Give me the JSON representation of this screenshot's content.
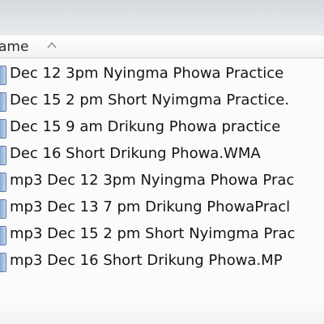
{
  "column_header": {
    "label": "ame"
  },
  "files": [
    {
      "name": "Dec 12 3pm Nyingma Phowa Practice",
      "icon": "audio-file-icon"
    },
    {
      "name": "Dec 15 2 pm Short Nyimgma Practice.",
      "icon": "audio-file-icon"
    },
    {
      "name": "Dec 15 9 am Drikung Phowa practice",
      "icon": "audio-file-icon"
    },
    {
      "name": "Dec 16 Short Drikung Phowa.WMA",
      "icon": "audio-file-icon"
    },
    {
      "name": "mp3 Dec 12 3pm Nyingma Phowa Prac",
      "icon": "audio-file-icon"
    },
    {
      "name": "mp3 Dec 13 7 pm Drikung PhowaPracl",
      "icon": "audio-file-icon"
    },
    {
      "name": "mp3 Dec 15 2 pm Short Nyimgma Prac",
      "icon": "audio-file-icon"
    },
    {
      "name": "mp3 Dec 16 Short Drikung Phowa.MP",
      "icon": "audio-file-icon"
    }
  ]
}
